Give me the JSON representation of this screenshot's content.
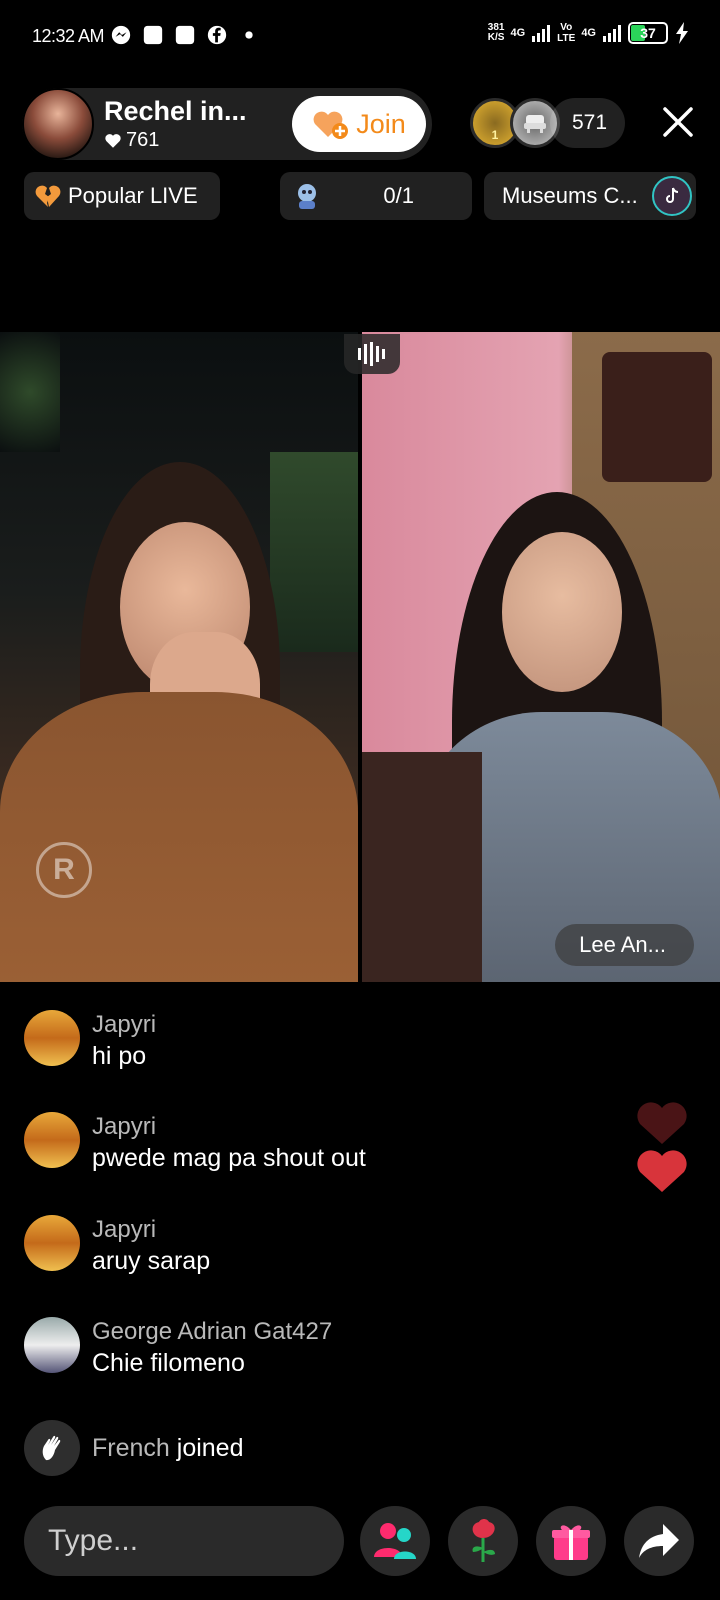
{
  "status_bar": {
    "time": "12:32 AM",
    "speed_value": "381",
    "speed_unit": "K/S",
    "net1": "4G",
    "volte_top": "Vo",
    "volte_bottom": "LTE",
    "net2": "4G",
    "battery": "37",
    "icons": [
      "messenger-icon",
      "square-notification-icon",
      "square-notification-icon",
      "facebook-icon",
      "dot-icon"
    ]
  },
  "host": {
    "name": "Rechel in...",
    "likes": "761",
    "join_label": "Join"
  },
  "viewers": {
    "count": "571",
    "badge1_rank": "1"
  },
  "pills": {
    "popular": "Popular LIVE",
    "goal": "0/1",
    "museum": "Museums C..."
  },
  "guest": {
    "name": "Lee An..."
  },
  "comments": [
    {
      "user": "Japyri",
      "text": "hi po"
    },
    {
      "user": "Japyri",
      "text": "pwede mag pa shout out"
    },
    {
      "user": "Japyri",
      "text": "aruy sarap"
    },
    {
      "user": "George Adrian Gat427",
      "text": "Chie filomeno"
    }
  ],
  "join_event": {
    "user": "French",
    "action": "joined"
  },
  "bottom": {
    "placeholder": "Type..."
  },
  "colors": {
    "join_text": "#f38a1a",
    "heart_red": "#d8343b",
    "people_icon": "#ff2b6e",
    "gift_icon": "#ff3b8a"
  }
}
